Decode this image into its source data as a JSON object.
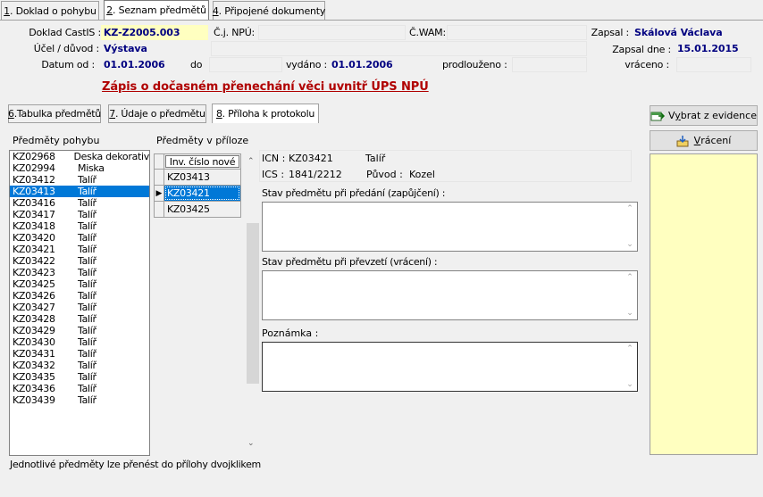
{
  "top_tabs": [
    {
      "key": "1",
      "label": ". Doklad  o pohybu"
    },
    {
      "key": "2",
      "label": ". Seznam předmětů"
    },
    {
      "key": "4",
      "label": ". Připojené dokumenty"
    }
  ],
  "header": {
    "doklad_label": "Doklad CastIS :",
    "doklad_value": "KZ-Z2005.003",
    "cj_label": "Č.j. NPÚ:",
    "cwam_label": "Č.WAM:",
    "zapsal_label": "Zapsal :",
    "zapsal_value": "Skálová Václava",
    "ucel_label": "Účel / důvod :",
    "ucel_value": "Výstava",
    "zapsal_dne_label": "Zapsal dne :",
    "zapsal_dne_value": "15.01.2015",
    "datum_od_label": "Datum od :",
    "datum_od_value": "01.01.2006",
    "do_label": "do",
    "vydano_label": "vydáno :",
    "vydano_value": "01.01.2006",
    "prodlouzeno_label": "prodlouženo :",
    "vraceno_label": "vráceno :"
  },
  "form_title": "Zápis o dočasném přenechání věci uvnitř ÚPS NPÚ",
  "sub_tabs": [
    {
      "key": "6",
      "label": ".Tabulka předmětů"
    },
    {
      "key": "7",
      "label": ". Údaje o předmětu"
    },
    {
      "key": "8",
      "label": ". Příloha k protokolu"
    }
  ],
  "buttons": {
    "vybrat_pre": "V",
    "vybrat_key": "y",
    "vybrat_post": "brat z evidence",
    "vraceni_key": "V",
    "vraceni_post": "rácení"
  },
  "left_list": {
    "title": "Předměty pohybu",
    "items": [
      [
        "KZ02968",
        "Deska dekorativ"
      ],
      [
        "KZ02994",
        "Miska"
      ],
      [
        "KZ03412",
        "Talíř"
      ],
      [
        "KZ03413",
        "Talíř"
      ],
      [
        "KZ03416",
        "Talíř"
      ],
      [
        "KZ03417",
        "Talíř"
      ],
      [
        "KZ03418",
        "Talíř"
      ],
      [
        "KZ03420",
        "Talíř"
      ],
      [
        "KZ03421",
        "Talíř"
      ],
      [
        "KZ03422",
        "Talíř"
      ],
      [
        "KZ03423",
        "Talíř"
      ],
      [
        "KZ03425",
        "Talíř"
      ],
      [
        "KZ03426",
        "Talíř"
      ],
      [
        "KZ03427",
        "Talíř"
      ],
      [
        "KZ03428",
        "Talíř"
      ],
      [
        "KZ03429",
        "Talíř"
      ],
      [
        "KZ03430",
        "Talíř"
      ],
      [
        "KZ03431",
        "Talíř"
      ],
      [
        "KZ03432",
        "Talíř"
      ],
      [
        "KZ03435",
        "Talíř"
      ],
      [
        "KZ03436",
        "Talíř"
      ],
      [
        "KZ03439",
        "Talíř"
      ]
    ],
    "selected_index": 3,
    "hint": "Jednotlivé předměty lze přenést do přílohy dvojklikem"
  },
  "attachment": {
    "title": "Předměty v příloze",
    "column_header": "Inv. číslo nové",
    "rows": [
      "KZ03413",
      "KZ03421",
      "KZ03425"
    ],
    "selected_index": 1
  },
  "detail": {
    "icn_label": "ICN :",
    "icn_value": "KZ03421",
    "name_value": "Talíř",
    "ics_label": "ICS :",
    "ics_value": "1841/2212",
    "puvod_label": "Původ :",
    "puvod_value": "Kozel",
    "stav_predani_label": "Stav předmětu při předání (zapůjčení) :",
    "stav_prevzeti_label": "Stav předmětu při převzetí (vrácení) :",
    "poznamka_label": "Poznámka :"
  },
  "colors": {
    "selection": "#0078d7",
    "title_red": "#b00000",
    "value_blue": "#000080",
    "highlight_yellow": "#ffffc0",
    "side_panel": "#ffffc0"
  }
}
